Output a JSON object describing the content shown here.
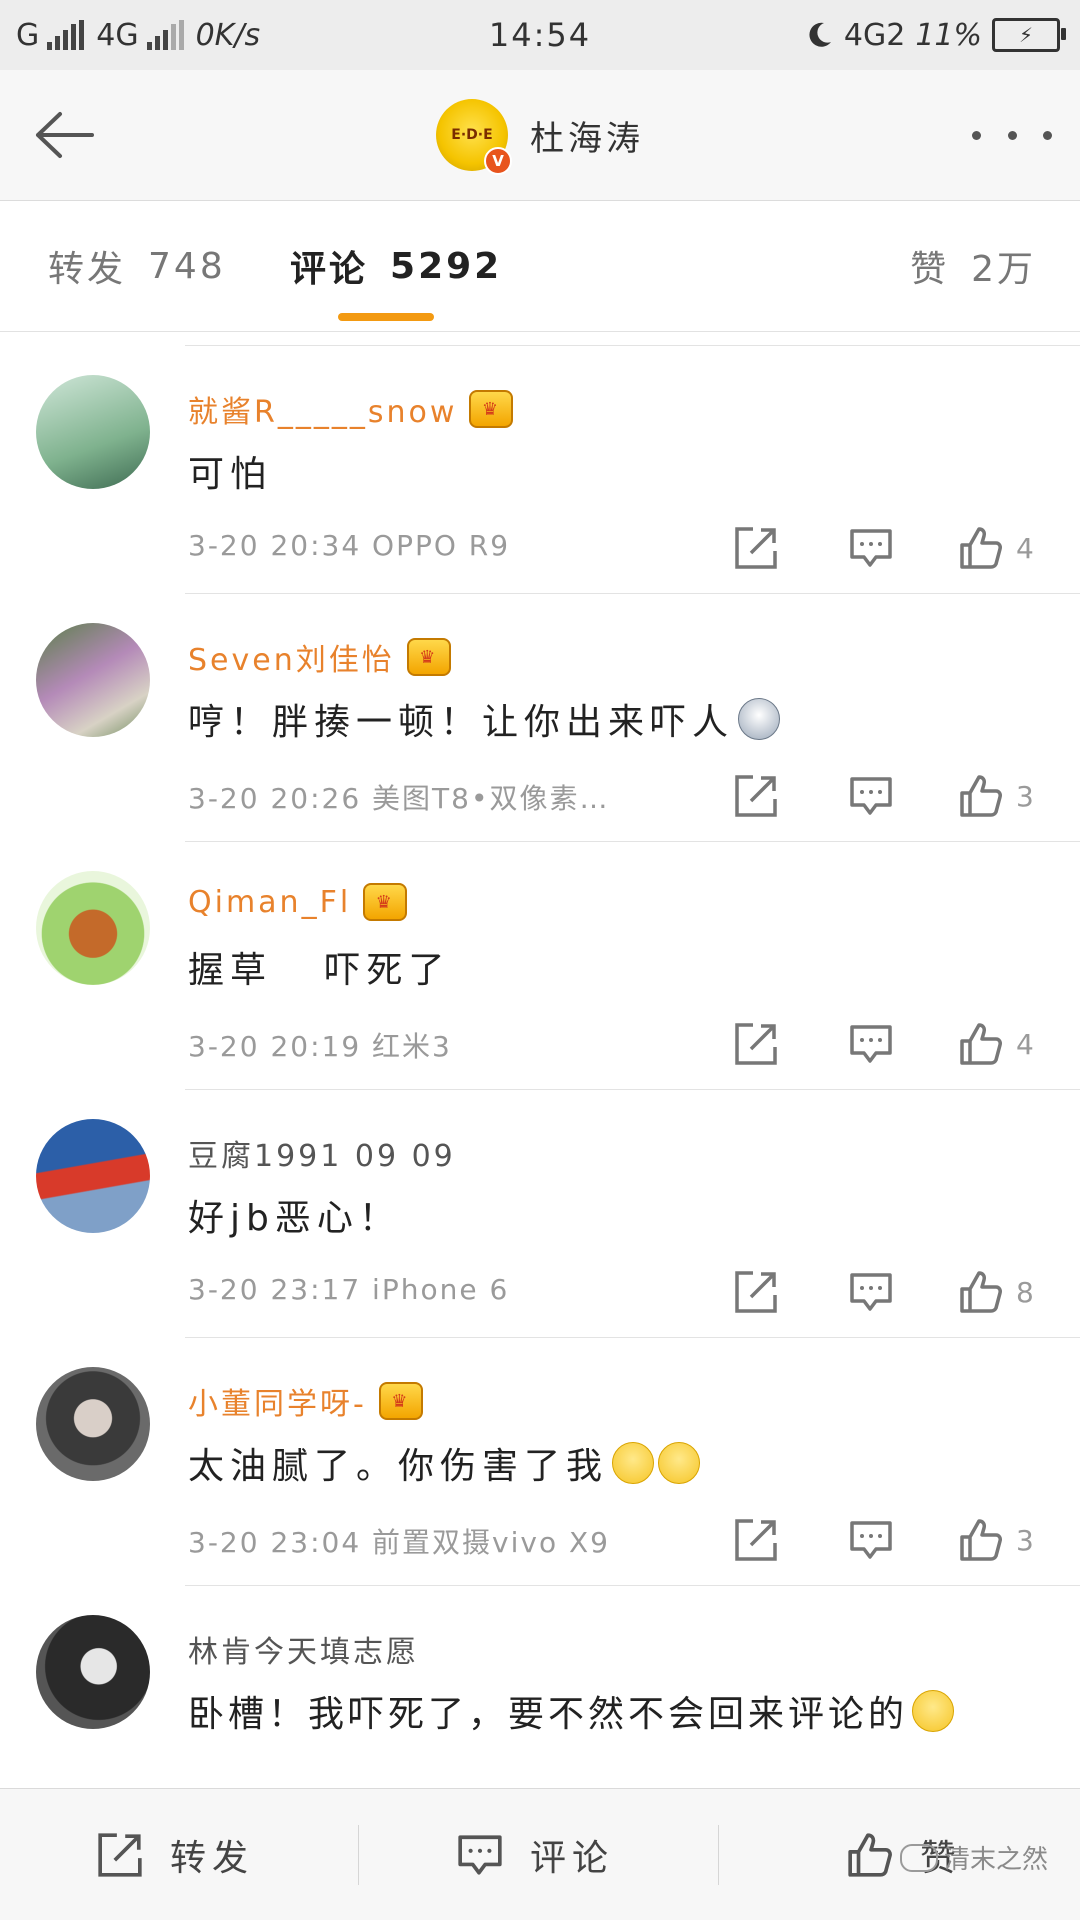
{
  "status_bar": {
    "carrier_1": "G",
    "carrier_2": "4G",
    "speed": "0K/s",
    "time": "14:54",
    "network": "4G2",
    "battery": "11%"
  },
  "header": {
    "title": "杜海涛",
    "avatar_text": "E·D·E",
    "verified_badge": "V"
  },
  "tabs": {
    "repost": {
      "label": "转发",
      "count": "748"
    },
    "comment": {
      "label": "评论",
      "count": "5292"
    },
    "like": {
      "label": "赞",
      "count": "2万"
    }
  },
  "comments": [
    {
      "username": "就酱R_____snow",
      "vip": true,
      "text": "可怕",
      "time": "3-20 20:34",
      "device": "OPPO R9",
      "likes": "4",
      "emoji": ""
    },
    {
      "username": "Seven刘佳怡",
      "vip": true,
      "text": "哼！胖揍一顿！让你出来吓人",
      "time": "3-20 20:26",
      "device": "美图T8•双像素…",
      "likes": "3",
      "emoji": "husky"
    },
    {
      "username": "Qiman_Fl",
      "vip": true,
      "text": "握草   吓死了",
      "time": "3-20 20:19",
      "device": "红米3",
      "likes": "4",
      "emoji": ""
    },
    {
      "username": "豆腐1991 09 09",
      "vip": false,
      "text": "好jb恶心！",
      "time": "3-20 23:17",
      "device": "iPhone 6",
      "likes": "8",
      "emoji": ""
    },
    {
      "username": "小董同学呀-",
      "vip": true,
      "text": "太油腻了。你伤害了我",
      "time": "3-20 23:04",
      "device": "前置双摄vivo X9",
      "likes": "3",
      "emoji": "smile-x2"
    },
    {
      "username": "林肯今天填志愿",
      "vip": false,
      "text": "卧槽！我吓死了，要不然不会回来评论的",
      "time": "",
      "device": "",
      "likes": "",
      "emoji": "laugh-cry"
    }
  ],
  "bottom_bar": {
    "repost_label": "转发",
    "comment_label": "评论",
    "like_label": "赞",
    "watermark": "清末之然"
  },
  "icons": {
    "back": "arrow-left-icon",
    "more": "more-dots-icon",
    "repost": "share-arrow-icon",
    "comment": "comment-bubble-icon",
    "like": "thumbs-up-icon"
  },
  "colors": {
    "accent": "#f39a12",
    "vip_name": "#e8822c",
    "meta_text": "#9a9a9a"
  }
}
